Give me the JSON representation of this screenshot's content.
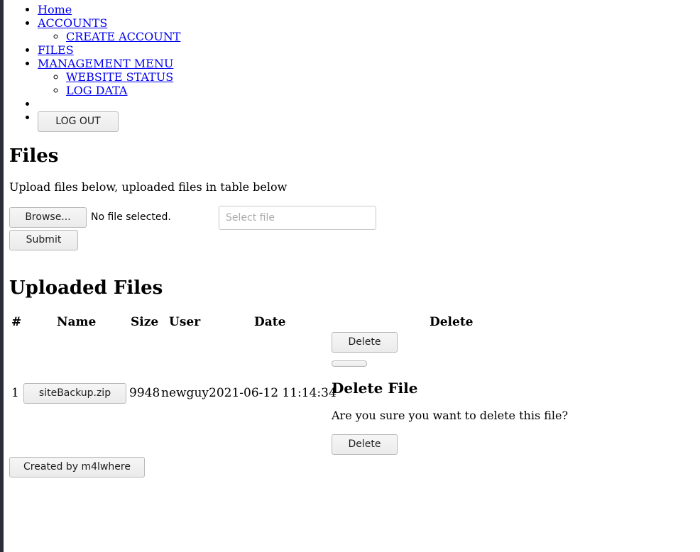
{
  "nav": {
    "home": "Home",
    "accounts": "ACCOUNTS",
    "create_account": "CREATE ACCOUNT",
    "files": "FILES",
    "management_menu": "MANAGEMENT MENU",
    "website_status": "WEBSITE STATUS",
    "log_data": "LOG DATA",
    "logout": "LOG OUT"
  },
  "page": {
    "title": "Files",
    "intro": "Upload files below, uploaded files in table below"
  },
  "upload": {
    "browse_label": "Browse...",
    "no_file_text": "No file selected.",
    "select_placeholder": "Select file",
    "submit_label": "Submit"
  },
  "uploaded": {
    "heading": "Uploaded Files",
    "headers": {
      "num": "#",
      "name": "Name",
      "size": "Size",
      "user": "User",
      "date": "Date",
      "delete": "Delete"
    },
    "rows": [
      {
        "num": "1",
        "name": "siteBackup.zip",
        "size": "9948",
        "user": "newguy",
        "date": "2021-06-12 11:14:34",
        "delete_label": "Delete"
      }
    ]
  },
  "modal": {
    "title": "Delete File",
    "text": "Are you sure you want to delete this file?",
    "confirm_label": "Delete"
  },
  "footer": {
    "credit": "Created by m4lwhere"
  }
}
